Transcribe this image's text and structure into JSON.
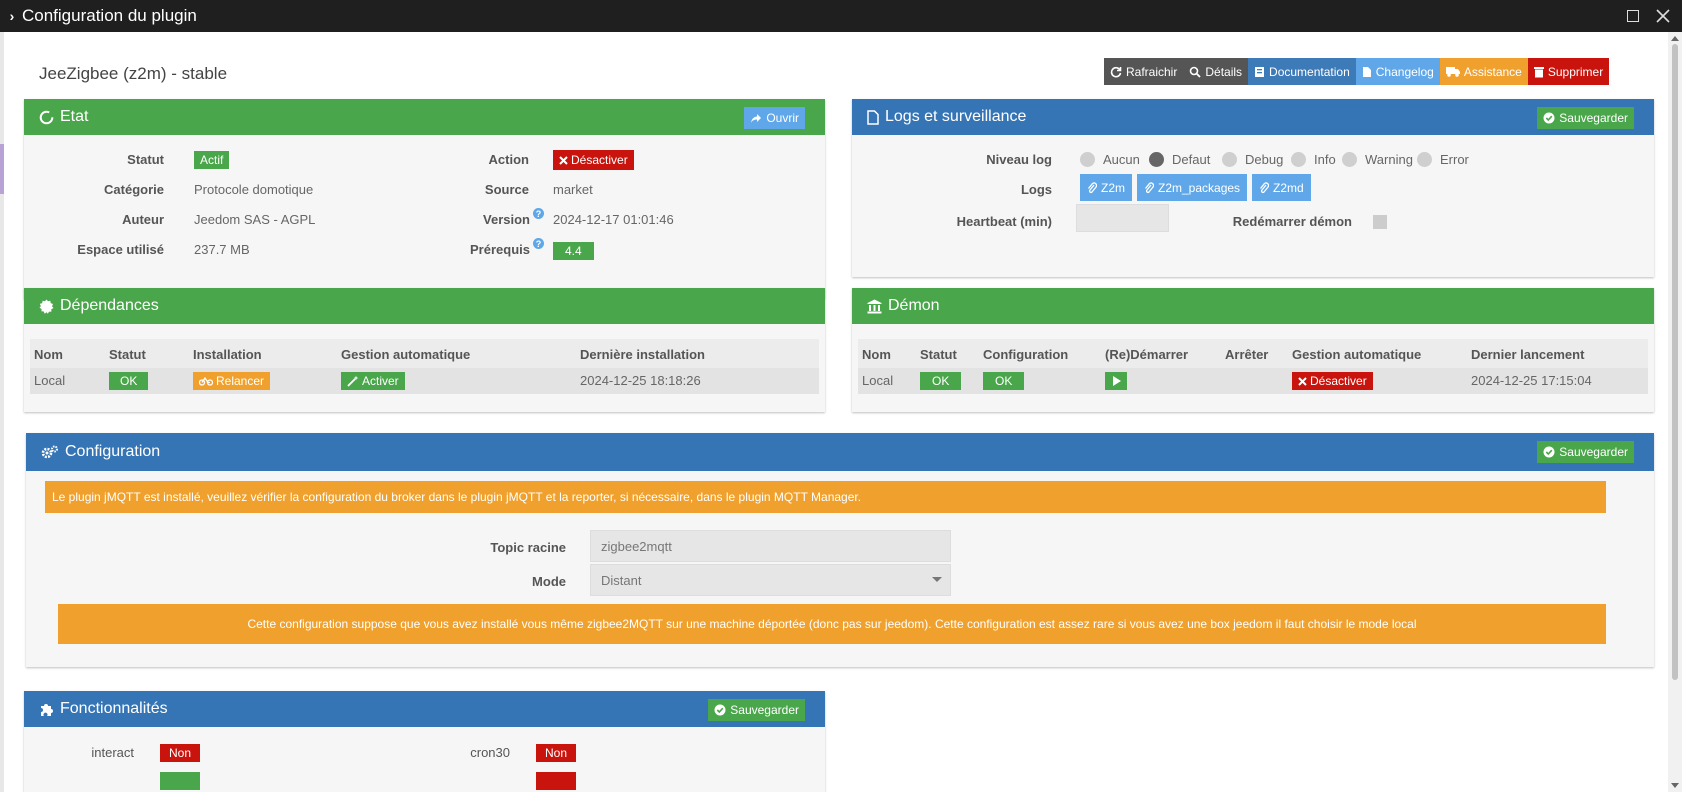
{
  "window": {
    "title": "Configuration du plugin"
  },
  "plugin": {
    "title": "JeeZigbee (z2m) - stable"
  },
  "toolbar": {
    "refresh": "Rafraichir",
    "details": "Détails",
    "documentation": "Documentation",
    "changelog": "Changelog",
    "assistance": "Assistance",
    "delete": "Supprimer"
  },
  "etat": {
    "title": "Etat",
    "open_btn": "Ouvrir",
    "statut_label": "Statut",
    "statut_value": "Actif",
    "categorie_label": "Catégorie",
    "categorie_value": "Protocole domotique",
    "auteur_label": "Auteur",
    "auteur_value": "Jeedom SAS - AGPL",
    "espace_label": "Espace utilisé",
    "espace_value": "237.7 MB",
    "action_label": "Action",
    "action_btn": "Désactiver",
    "source_label": "Source",
    "source_value": "market",
    "version_label": "Version",
    "version_value": "2024-12-17 01:01:46",
    "prerequis_label": "Prérequis",
    "prerequis_value": "4.4"
  },
  "logs": {
    "title": "Logs et surveillance",
    "save": "Sauvegarder",
    "niveau_label": "Niveau log",
    "levels": [
      "Aucun",
      "Defaut",
      "Debug",
      "Info",
      "Warning",
      "Error"
    ],
    "selected_level": "Defaut",
    "logs_label": "Logs",
    "log_buttons": [
      "Z2m",
      "Z2m_packages",
      "Z2md"
    ],
    "heartbeat_label": "Heartbeat (min)",
    "heartbeat_value": "",
    "restart_label": "Redémarrer démon"
  },
  "dependances": {
    "title": "Dépendances",
    "headers": [
      "Nom",
      "Statut",
      "Installation",
      "Gestion automatique",
      "Dernière installation"
    ],
    "row": {
      "nom": "Local",
      "statut": "OK",
      "installation": "Relancer",
      "gestion": "Activer",
      "derniere": "2024-12-25 18:18:26"
    }
  },
  "demon": {
    "title": "Démon",
    "headers": [
      "Nom",
      "Statut",
      "Configuration",
      "(Re)Démarrer",
      "Arrêter",
      "Gestion automatique",
      "Dernier lancement"
    ],
    "row": {
      "nom": "Local",
      "statut": "OK",
      "configuration": "OK",
      "gestion": "Désactiver",
      "dernier": "2024-12-25 17:15:04"
    }
  },
  "configuration": {
    "title": "Configuration",
    "save": "Sauvegarder",
    "alert1": "Le plugin jMQTT est installé, veuillez vérifier la configuration du broker dans le plugin jMQTT et la reporter, si nécessaire, dans le plugin MQTT Manager.",
    "topic_label": "Topic racine",
    "topic_value": "zigbee2mqtt",
    "mode_label": "Mode",
    "mode_value": "Distant",
    "alert2": "Cette configuration suppose que vous avez installé vous même zigbee2MQTT sur une machine déportée (donc pas sur jeedom). Cette configuration est assez rare si vous avez une box jeedom il faut choisir le mode local"
  },
  "fonctionnalites": {
    "title": "Fonctionnalités",
    "save": "Sauvegarder",
    "interact_label": "interact",
    "interact_value": "Non",
    "cron30_label": "cron30",
    "cron30_value": "Non"
  },
  "colors": {
    "green": "#4aa64a",
    "blue": "#3675b5",
    "red": "#c9140d",
    "orange": "#f0a02c",
    "light_blue": "#5fa7e8"
  }
}
